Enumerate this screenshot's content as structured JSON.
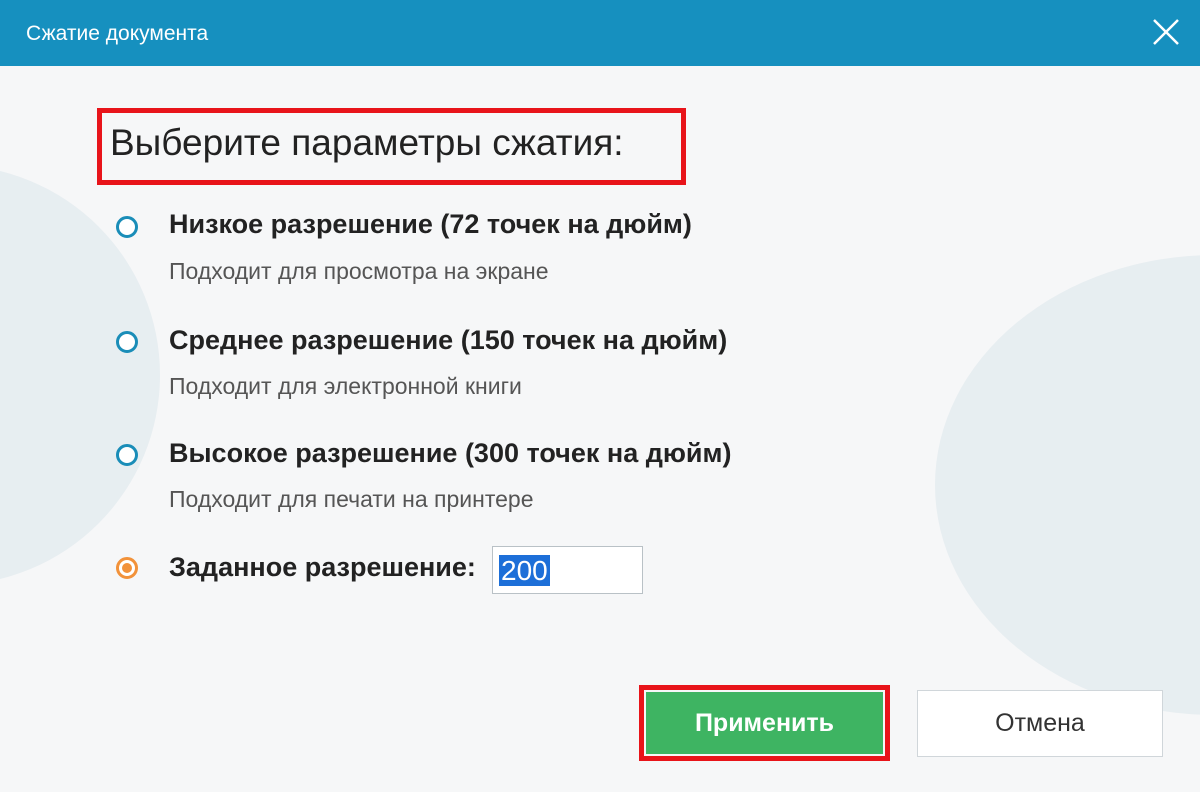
{
  "window": {
    "title": "Сжатие документа",
    "close_icon": "close-icon"
  },
  "heading": "Выберите параметры сжатия:",
  "options": [
    {
      "label": "Низкое разрешение (72 точек на дюйм)",
      "description": "Подходит для просмотра на экране",
      "selected": false
    },
    {
      "label": "Среднее разрешение (150 точек на дюйм)",
      "description": "Подходит для электронной книги",
      "selected": false
    },
    {
      "label": "Высокое разрешение (300 точек на дюйм)",
      "description": "Подходит для печати на принтере",
      "selected": false
    },
    {
      "label": "Заданное разрешение:",
      "selected": true
    }
  ],
  "custom_dpi": {
    "value": "200"
  },
  "buttons": {
    "apply": "Применить",
    "cancel": "Отмена"
  },
  "colors": {
    "titlebar": "#1690bf",
    "radio": "#1a8db8",
    "radio_selected": "#f2923a",
    "apply": "#3eb462",
    "highlight": "#e8141a"
  }
}
